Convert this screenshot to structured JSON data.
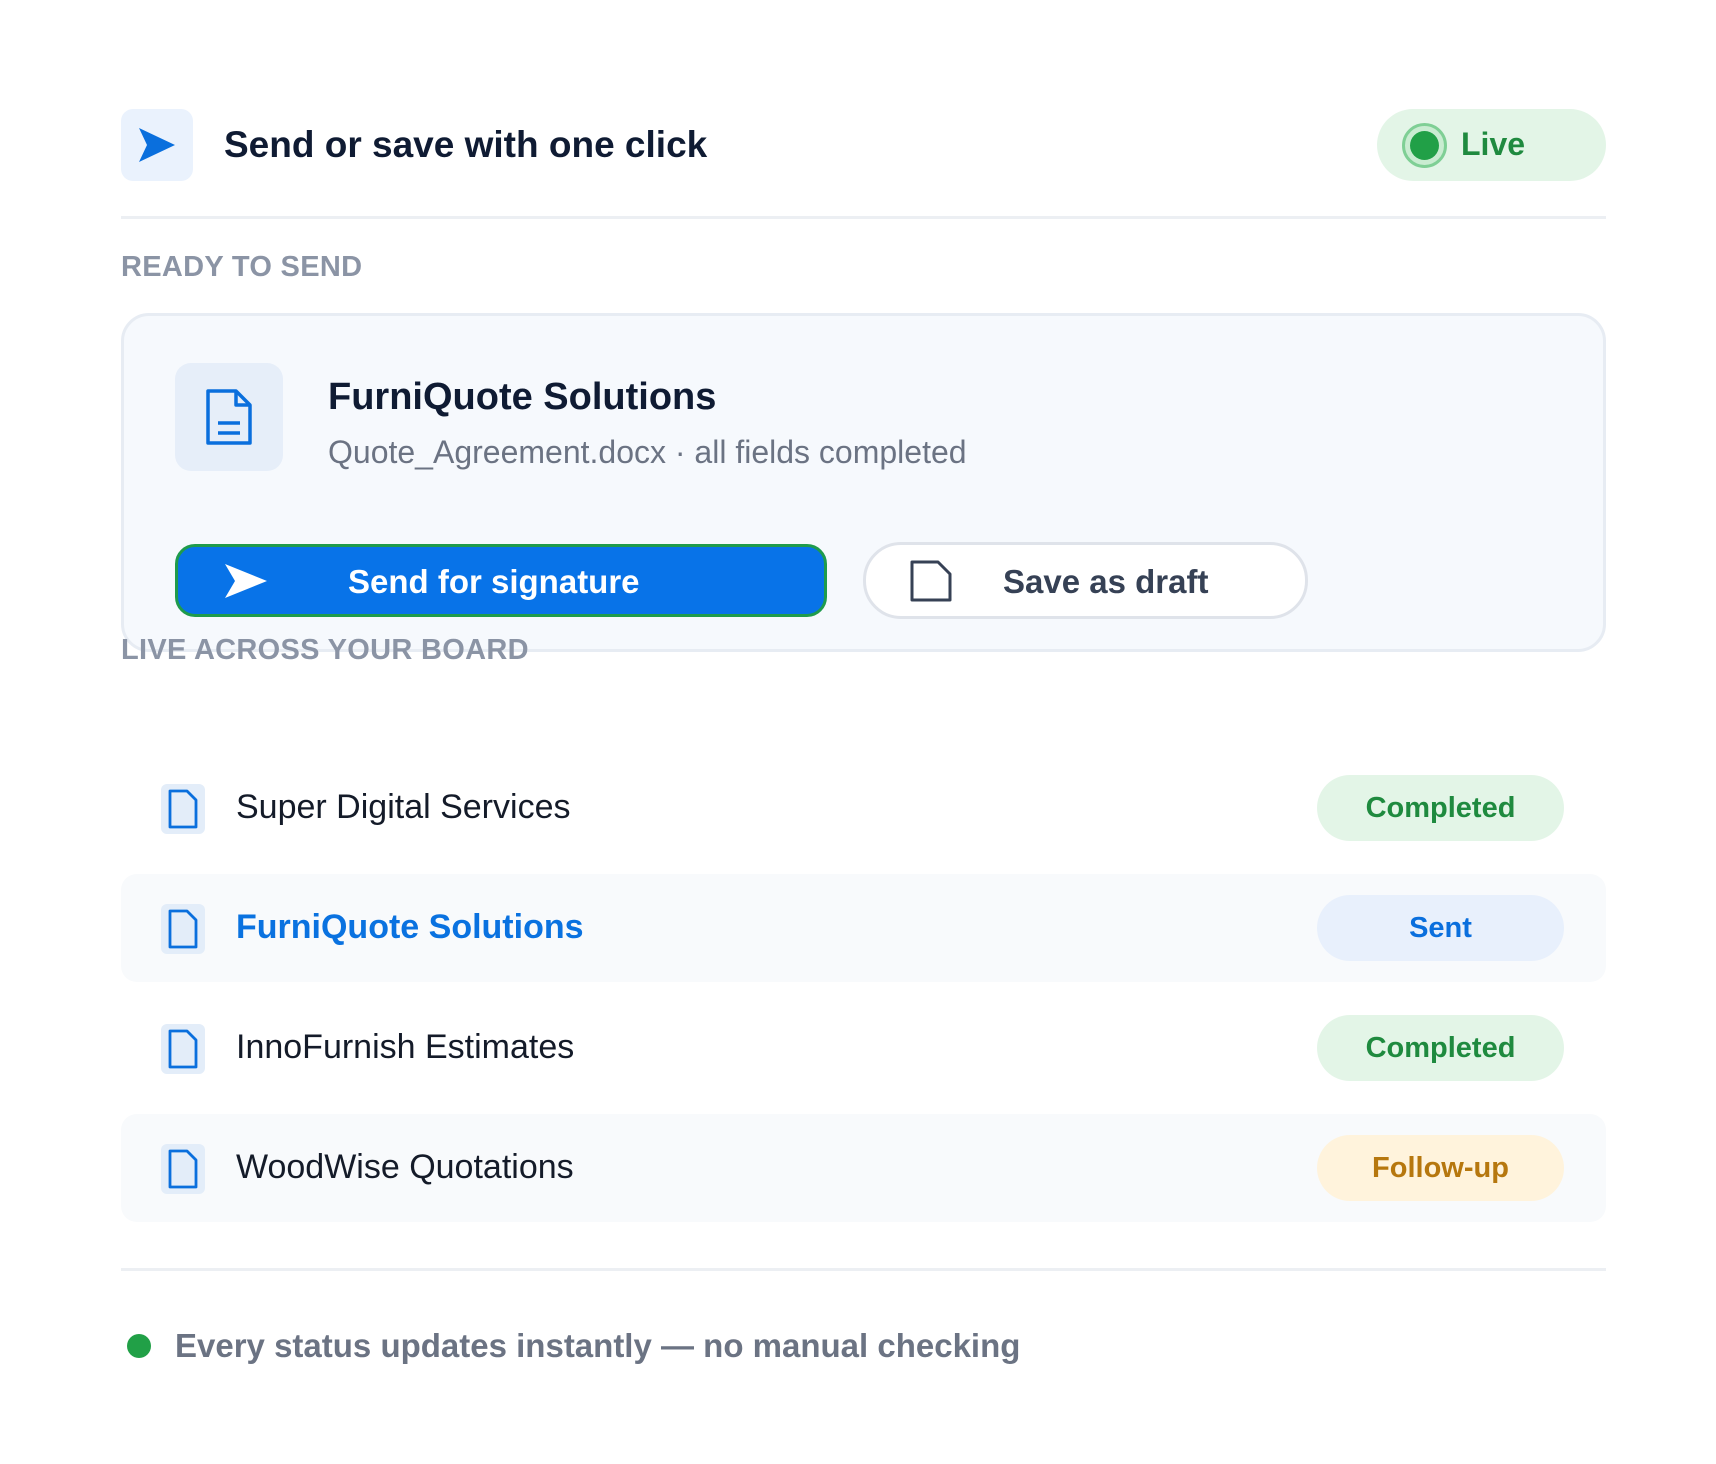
{
  "header": {
    "title": "Send or save with one click",
    "icon": "send-icon",
    "status_label": "Live",
    "status_color": "#21a047"
  },
  "ready_section": {
    "label": "READY TO SEND",
    "card": {
      "icon": "document-icon",
      "title": "FurniQuote Solutions",
      "subtitle": "Quote_Agreement.docx · all fields completed",
      "primary_button": "Send for signature",
      "secondary_button": "Save as draft"
    }
  },
  "board_section": {
    "label": "LIVE ACROSS YOUR BOARD",
    "rows": [
      {
        "name": "Super Digital Services",
        "status": "Completed"
      },
      {
        "name": "FurniQuote Solutions",
        "status": "Sent"
      },
      {
        "name": "InnoFurnish Estimates",
        "status": "Completed"
      },
      {
        "name": "WoodWise Quotations",
        "status": "Follow-up"
      }
    ]
  },
  "footer": {
    "text": "Every status updates instantly — no manual checking"
  },
  "colors": {
    "accent": "#0873e8",
    "completed": "#1f8a3f",
    "sent": "#0a6fdd",
    "followup": "#b6770e"
  }
}
